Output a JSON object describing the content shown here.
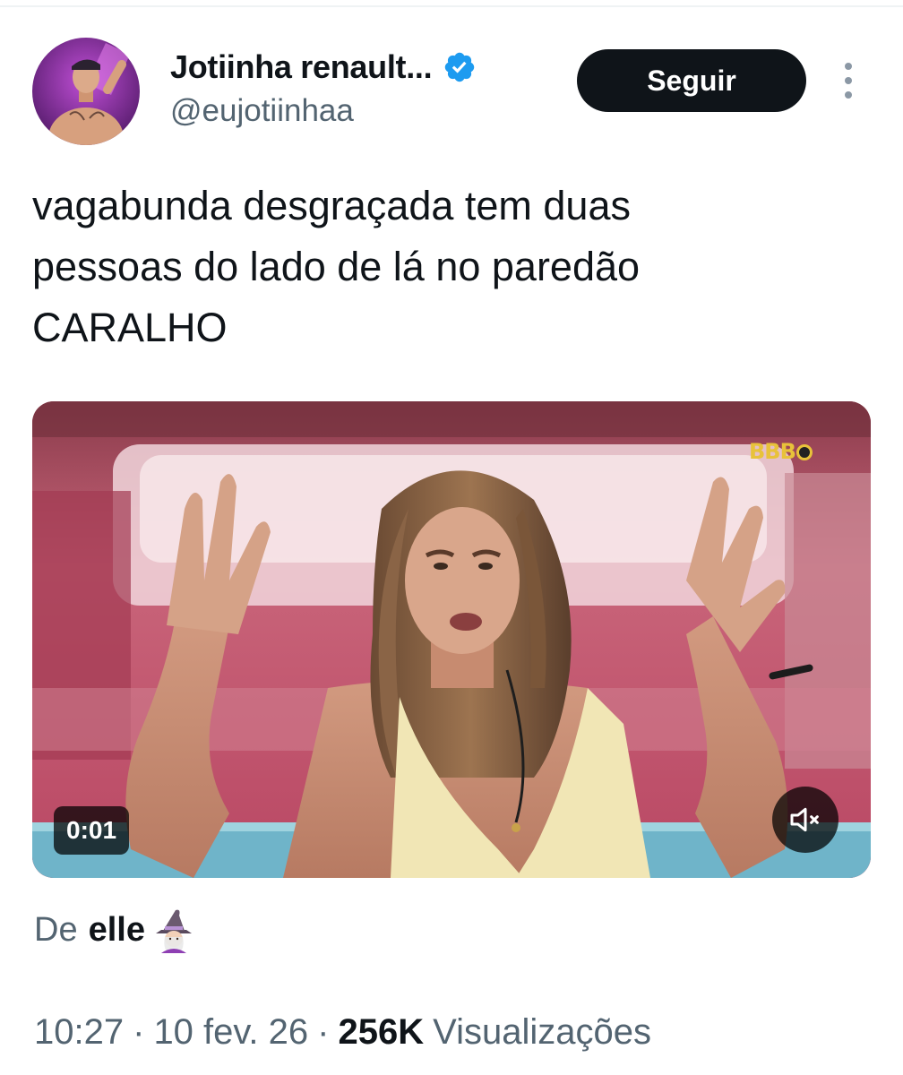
{
  "author": {
    "display_name": "Jotiinha renault...",
    "handle": "@eujotiinhaa",
    "verified": true,
    "avatar_icon": "avatar-photo"
  },
  "actions": {
    "follow_label": "Seguir",
    "more_icon": "more-vertical-icon"
  },
  "tweet": {
    "text": "vagabunda desgraçada tem duas\npessoas do lado de lá no paredão\nCARALHO"
  },
  "media": {
    "type": "video",
    "duration": "0:01",
    "muted": true,
    "logo_text": "BBB",
    "mute_icon": "speaker-muted-icon"
  },
  "attribution": {
    "prefix": "De",
    "author": "elle",
    "emoji_icon": "witch-emoji-icon"
  },
  "meta": {
    "time": "10:27",
    "separator": "·",
    "date": "10 fev. 26",
    "views_count": "256K",
    "views_label": "Visualizações"
  },
  "colors": {
    "text_primary": "#0f1419",
    "text_secondary": "#536471",
    "follow_button_bg": "#0f1419",
    "verified_blue": "#1d9bf0"
  }
}
